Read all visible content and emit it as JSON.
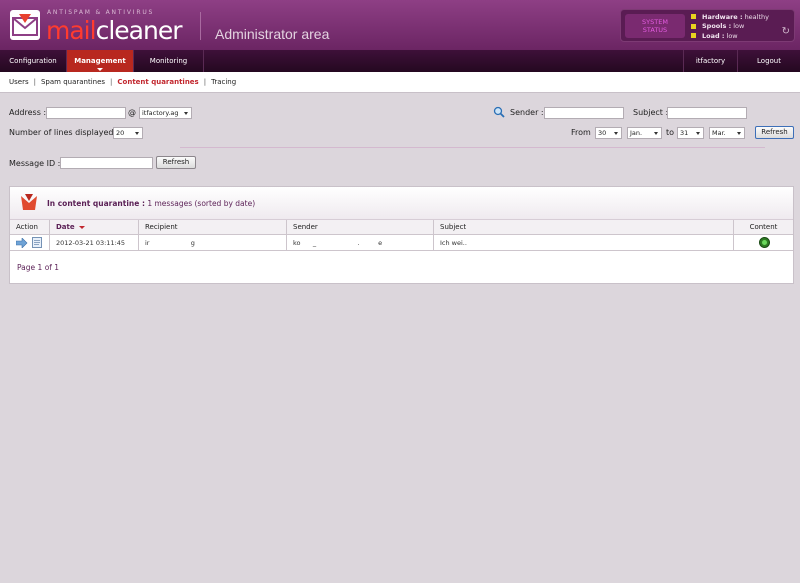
{
  "header": {
    "tagline": "ANTISPAM & ANTIVIRUS",
    "brand_mail": "mail",
    "brand_cleaner": "cleaner",
    "title": "Administrator area",
    "system_status_label_line1": "SYSTEM",
    "system_status_label_line2": "STATUS",
    "status": [
      {
        "name": "Hardware :",
        "value": "healthy"
      },
      {
        "name": "Spools :",
        "value": "low"
      },
      {
        "name": "Load :",
        "value": "low"
      }
    ]
  },
  "nav": {
    "configuration": "Configuration",
    "management": "Management",
    "monitoring": "Monitoring",
    "user": "itfactory",
    "logout": "Logout"
  },
  "subnav": {
    "users": "Users",
    "spam": "Spam quarantines",
    "content": "Content quarantines",
    "tracing": "Tracing"
  },
  "filters": {
    "address_label": "Address :",
    "address_value": "",
    "at": "@",
    "domain": "itfactory.ag",
    "lines_label": "Number of lines displayed :",
    "lines_value": "20",
    "sender_label": "Sender :",
    "sender_value": "",
    "subject_label": "Subject :",
    "subject_value": "",
    "from_label": "From",
    "from_day": "30",
    "from_month": "Jan.",
    "to_label": "to",
    "to_day": "31",
    "to_month": "Mar.",
    "refresh": "Refresh",
    "msgid_label": "Message ID :",
    "msgid_value": "",
    "msgid_refresh": "Refresh"
  },
  "results": {
    "title_bold": "In content quarantine :",
    "title_rest": "1 messages (sorted by date)",
    "columns": [
      "Action",
      "Date",
      "Recipient",
      "Sender",
      "Subject",
      "Content"
    ],
    "rows": [
      {
        "date": "2012-03-21   03:11:45",
        "recipient": "ir                    g",
        "sender": "ko      _                    .         e",
        "subject": "Ich wei..",
        "content_status": "ok"
      }
    ],
    "pagination": "Page 1 of 1"
  },
  "colors": {
    "header": "#7a2f70",
    "accent_red": "#c2272e",
    "nav": "#2e0c29",
    "status_ok": "#2d7a23"
  }
}
